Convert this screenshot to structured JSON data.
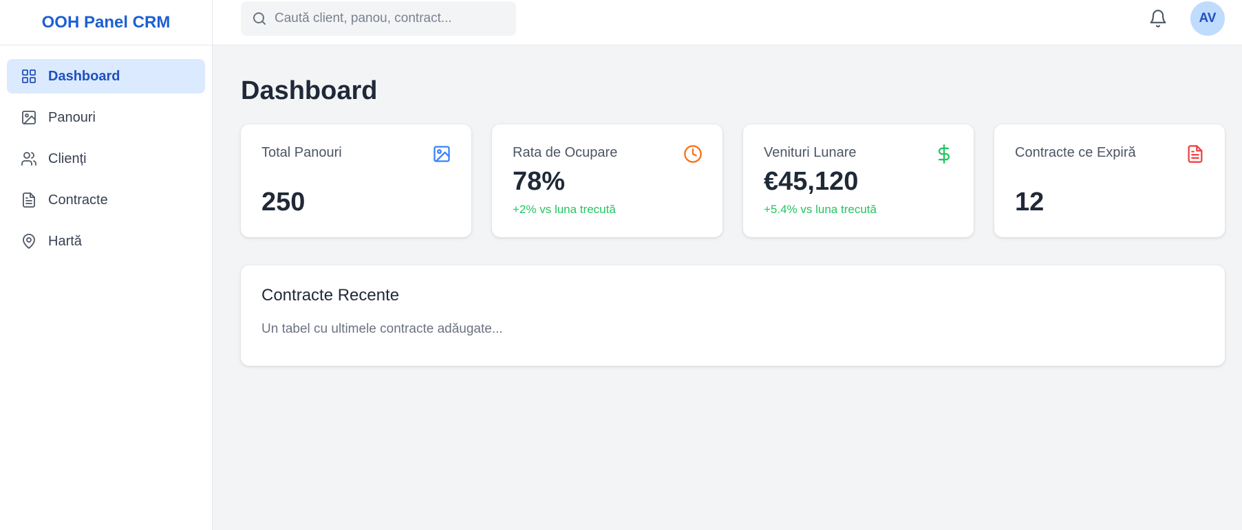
{
  "app": {
    "brand": "OOH Panel CRM"
  },
  "sidebar": {
    "items": [
      {
        "label": "Dashboard",
        "icon": "grid-icon",
        "active": true
      },
      {
        "label": "Panouri",
        "icon": "image-icon"
      },
      {
        "label": "Clienți",
        "icon": "users-icon"
      },
      {
        "label": "Contracte",
        "icon": "document-icon"
      },
      {
        "label": "Hartă",
        "icon": "map-pin-icon"
      }
    ]
  },
  "header": {
    "search_placeholder": "Caută client, panou, contract...",
    "avatar_initials": "AV"
  },
  "main": {
    "title": "Dashboard",
    "cards": [
      {
        "label": "Total Panouri",
        "value": "250",
        "change": "",
        "icon": "image-icon",
        "icon_color": "#3b82f6"
      },
      {
        "label": "Rata de Ocupare",
        "value": "78%",
        "change": "+2% vs luna trecută",
        "icon": "clock-icon",
        "icon_color": "#f97316"
      },
      {
        "label": "Venituri Lunare",
        "value": "€45,120",
        "change": "+5.4% vs luna trecută",
        "icon": "dollar-icon",
        "icon_color": "#22c55e"
      },
      {
        "label": "Contracte ce Expiră",
        "value": "12",
        "change": "",
        "icon": "document-icon",
        "icon_color": "#ef4444"
      }
    ],
    "recent": {
      "title": "Contracte Recente",
      "description": "Un tabel cu ultimele contracte adăugate..."
    }
  },
  "colors": {
    "accent": "#1d5fd1",
    "active_bg": "#dbeafe",
    "positive": "#22c55e"
  }
}
